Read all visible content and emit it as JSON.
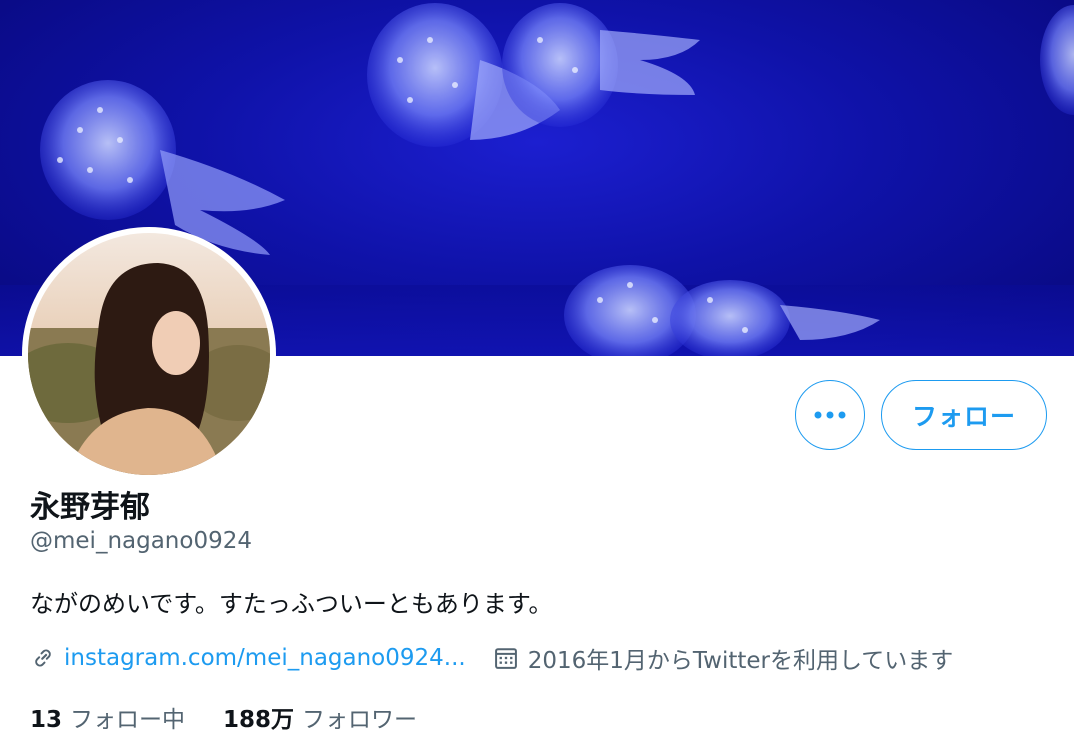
{
  "profile": {
    "display_name": "永野芽郁",
    "handle": "@mei_nagano0924",
    "bio": "ながのめいです。すたっふついーともあります。",
    "link_text": "instagram.com/mei_nagano0924...",
    "joined": "2016年1月からTwitterを利用しています"
  },
  "actions": {
    "follow_label": "フォロー",
    "more_label": "•••"
  },
  "stats": {
    "following_count": "13",
    "following_label": "フォロー中",
    "followers_count": "188万",
    "followers_label": "フォロワー"
  },
  "icons": {
    "link": "link-icon",
    "calendar": "calendar-icon",
    "more": "more-icon"
  },
  "colors": {
    "accent": "#1d9bf0",
    "text_primary": "#0f1419",
    "text_secondary": "#536471",
    "banner": "#0f12a8"
  }
}
